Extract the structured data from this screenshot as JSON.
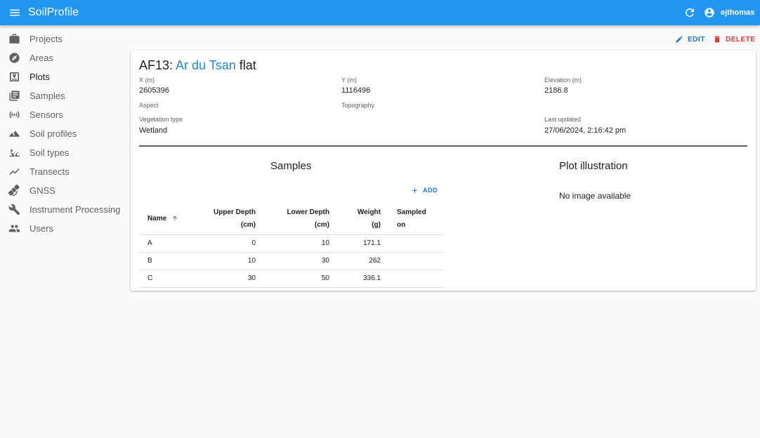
{
  "app": {
    "title": "SoilProfile",
    "username": "ejthomas"
  },
  "sidebar": {
    "items": [
      {
        "label": "Projects",
        "icon": "briefcase-icon"
      },
      {
        "label": "Areas",
        "icon": "compass-icon"
      },
      {
        "label": "Plots",
        "icon": "plot-icon"
      },
      {
        "label": "Samples",
        "icon": "samples-icon"
      },
      {
        "label": "Sensors",
        "icon": "sensor-icon"
      },
      {
        "label": "Soil profiles",
        "icon": "terrain-icon"
      },
      {
        "label": "Soil types",
        "icon": "grass-icon"
      },
      {
        "label": "Transects",
        "icon": "line-chart-icon"
      },
      {
        "label": "GNSS",
        "icon": "satellite-icon"
      },
      {
        "label": "Instrument Processing",
        "icon": "wrench-icon"
      },
      {
        "label": "Users",
        "icon": "users-icon"
      }
    ]
  },
  "actions": {
    "edit_label": "EDIT",
    "delete_label": "DELETE"
  },
  "plot": {
    "name_prefix": "AF13:",
    "area_name": "Ar du Tsan",
    "name_suffix": "flat",
    "fields": {
      "x_label": "X (m)",
      "x_value": "2605396",
      "y_label": "Y (m)",
      "y_value": "1116496",
      "elevation_label": "Elevation (m)",
      "elevation_value": "2186.8",
      "aspect_label": "Aspect",
      "aspect_value": "",
      "topography_label": "Topography",
      "topography_value": "",
      "vegetation_label": "Vegetation type",
      "vegetation_value": "Wetland",
      "updated_label": "Last updated",
      "updated_value": "27/06/2024, 2:16:42 pm"
    }
  },
  "samples": {
    "title": "Samples",
    "add_label": "ADD",
    "columns": [
      {
        "line1": "Name",
        "line2": ""
      },
      {
        "line1": "Upper Depth",
        "line2": "(cm)"
      },
      {
        "line1": "Lower Depth",
        "line2": "(cm)"
      },
      {
        "line1": "Weight",
        "line2": "(g)"
      },
      {
        "line1": "Sampled",
        "line2": "on"
      }
    ],
    "rows": [
      {
        "name": "A",
        "upper": "0",
        "lower": "10",
        "weight": "171.1",
        "sampled_on": ""
      },
      {
        "name": "B",
        "upper": "10",
        "lower": "30",
        "weight": "262",
        "sampled_on": ""
      },
      {
        "name": "C",
        "upper": "30",
        "lower": "50",
        "weight": "336.1",
        "sampled_on": ""
      }
    ]
  },
  "illustration": {
    "title": "Plot illustration",
    "empty_text": "No image available"
  },
  "colors": {
    "primary": "#2196f3",
    "link": "#1e88e5",
    "danger": "#e53935",
    "icon": "#616161"
  }
}
